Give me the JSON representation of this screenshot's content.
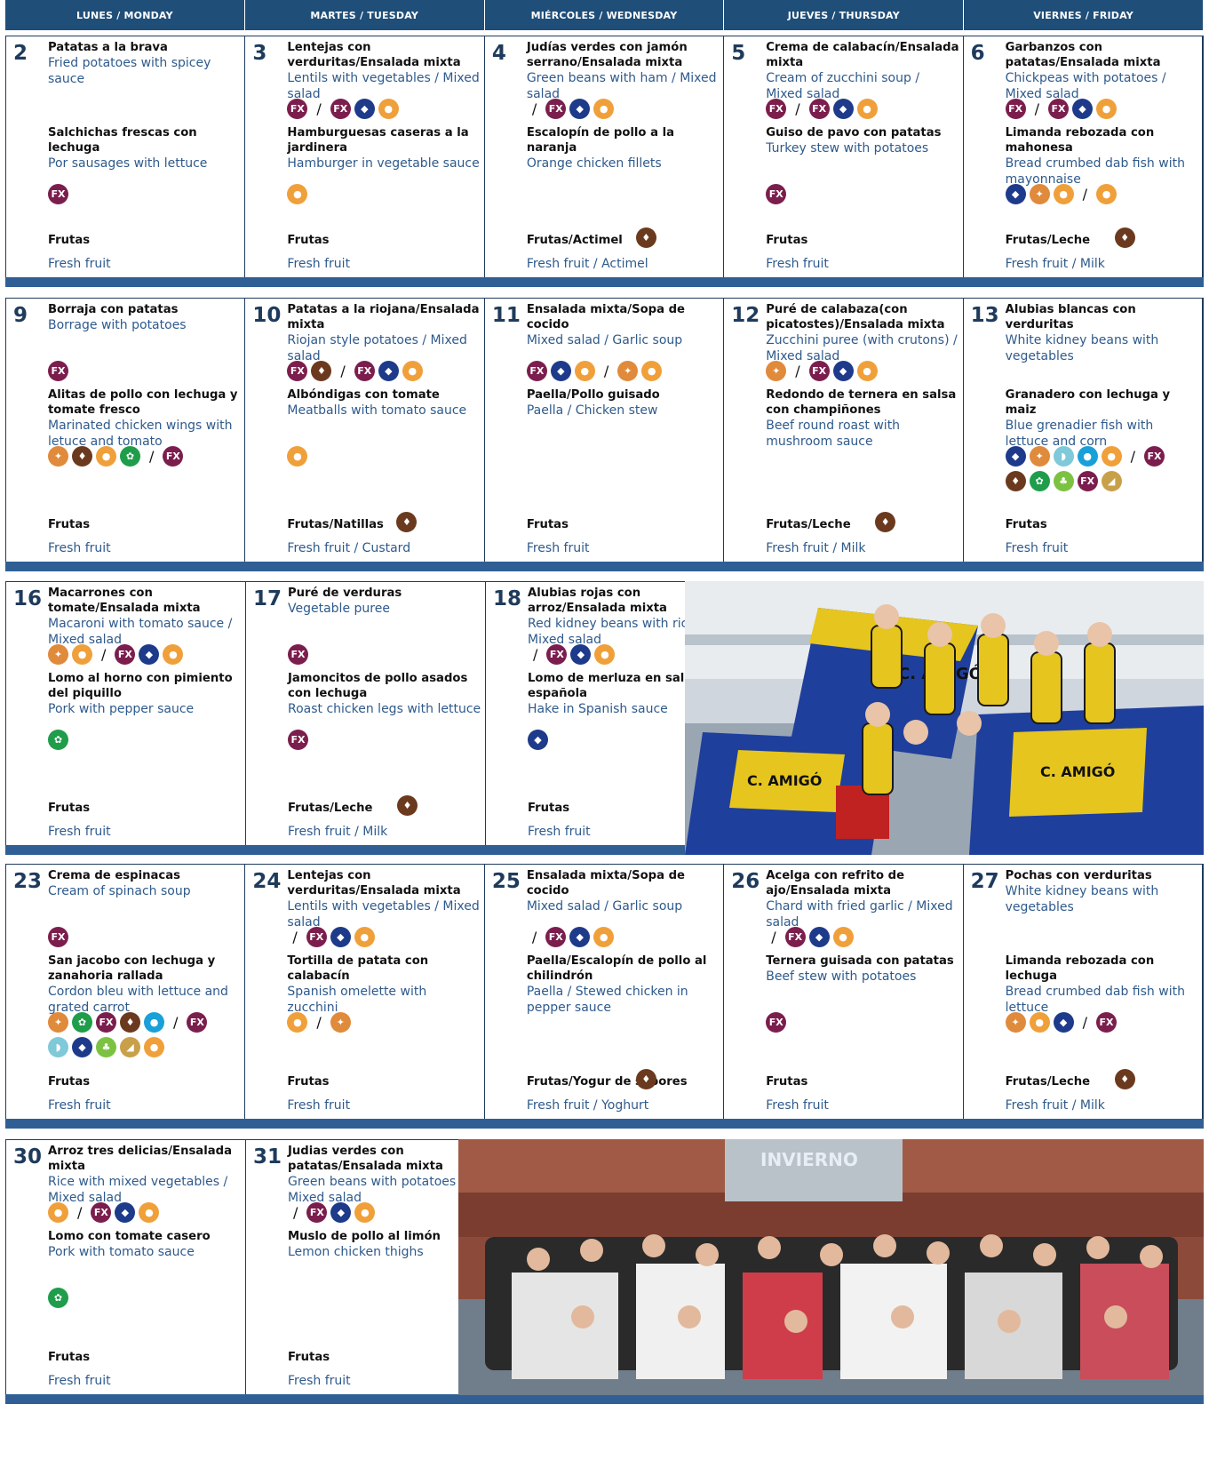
{
  "header": [
    "LUNES / MONDAY",
    "MARTES / TUESDAY",
    "MIÉRCOLES / WEDNESDAY",
    "JUEVES / THURSDAY",
    "VIERNES / FRIDAY"
  ],
  "weeks": [
    {
      "days": [
        {
          "num": "2",
          "d1es": "Patatas a la brava",
          "d1en": "Fried potatoes with spicey sauce",
          "d2es": "Salchichas frescas con lechuga",
          "d2en": "Por sausages with lettuce",
          "fes": "Frutas",
          "fen": "Fresh fruit"
        },
        {
          "num": "3",
          "d1es": "Lentejas con verduritas/Ensalada mixta",
          "d1en": "Lentils with vegetables / Mixed salad",
          "d2es": "Hamburguesas caseras a la jardinera",
          "d2en": "Hamburger in vegetable sauce",
          "fes": "Frutas",
          "fen": "Fresh fruit"
        },
        {
          "num": "4",
          "d1es": "Judías verdes con jamón serrano/Ensalada mixta",
          "d1en": "Green beans with ham / Mixed salad",
          "d2es": "Escalopín de pollo a la naranja",
          "d2en": "Orange chicken fillets",
          "fes": "Frutas/Actimel",
          "fen": "Fresh fruit / Actimel"
        },
        {
          "num": "5",
          "d1es": "Crema de calabacín/Ensalada mixta",
          "d1en": "Cream of zucchini soup / Mixed salad",
          "d2es": "Guiso de pavo con patatas",
          "d2en": "Turkey stew with potatoes",
          "fes": "Frutas",
          "fen": "Fresh fruit"
        },
        {
          "num": "6",
          "d1es": "Garbanzos con patatas/Ensalada mixta",
          "d1en": "Chickpeas with potatoes / Mixed salad",
          "d2es": "Limanda rebozada con mahonesa",
          "d2en": "Bread crumbed dab fish with mayonnaise",
          "fes": "Frutas/Leche",
          "fen": "Fresh fruit / Milk"
        }
      ]
    },
    {
      "days": [
        {
          "num": "9",
          "d1es": "Borraja con patatas",
          "d1en": "Borrage with potatoes",
          "d2es": "Alitas de pollo con lechuga y tomate fresco",
          "d2en": "Marinated chicken wings with letuce and tomato",
          "fes": "Frutas",
          "fen": "Fresh fruit"
        },
        {
          "num": "10",
          "d1es": "Patatas a la riojana/Ensalada mixta",
          "d1en": "Riojan style potatoes / Mixed salad",
          "d2es": "Albóndigas con tomate",
          "d2en": "Meatballs with tomato sauce",
          "fes": "Frutas/Natillas",
          "fen": "Fresh fruit / Custard"
        },
        {
          "num": "11",
          "d1es": "Ensalada mixta/Sopa de cocido",
          "d1en": "Mixed salad / Garlic soup",
          "d2es": "Paella/Pollo guisado",
          "d2en": "Paella / Chicken stew",
          "fes": "Frutas",
          "fen": "Fresh fruit"
        },
        {
          "num": "12",
          "d1es": "Puré de calabaza(con picatostes)/Ensalada mixta",
          "d1en": "Zucchini puree (with crutons) / Mixed salad",
          "d2es": "Redondo de ternera en salsa con champiñones",
          "d2en": "Beef round roast with mushroom sauce",
          "fes": "Frutas/Leche",
          "fen": "Fresh fruit / Milk"
        },
        {
          "num": "13",
          "d1es": "Alubias blancas con verduritas",
          "d1en": "White kidney beans with vegetables",
          "d2es": "Granadero con lechuga y maiz",
          "d2en": "Blue grenadier fish with lettuce and corn",
          "fes": "Frutas",
          "fen": "Fresh fruit"
        }
      ]
    },
    {
      "days": [
        {
          "num": "16",
          "d1es": "Macarrones con tomate/Ensalada mixta",
          "d1en": "Macaroni with tomato sauce / Mixed salad",
          "d2es": "Lomo al horno con pimiento del piquillo",
          "d2en": "Pork with pepper sauce",
          "fes": "Frutas",
          "fen": "Fresh fruit"
        },
        {
          "num": "17",
          "d1es": "Puré de verduras",
          "d1en": "Vegetable puree",
          "d2es": "Jamoncitos de pollo  asados con lechuga",
          "d2en": "Roast chicken legs with lettuce",
          "fes": "Frutas/Leche",
          "fen": "Fresh fruit / Milk"
        },
        {
          "num": "18",
          "d1es": "Alubias rojas con arroz/Ensalada mixta",
          "d1en": "Red kidney beans with rice / Mixed salad",
          "d2es": "Lomo de merluza en salsa española",
          "d2en": "Hake in Spanish sauce",
          "fes": "Frutas",
          "fen": "Fresh fruit"
        }
      ]
    },
    {
      "days": [
        {
          "num": "23",
          "d1es": "Crema de espinacas",
          "d1en": "Cream of spinach soup",
          "d2es": "San jacobo con lechuga  y zanahoria rallada",
          "d2en": "Cordon bleu with lettuce and grated carrot",
          "fes": "Frutas",
          "fen": "Fresh fruit"
        },
        {
          "num": "24",
          "d1es": "Lentejas con verduritas/Ensalada mixta",
          "d1en": "Lentils with vegetables / Mixed salad",
          "d2es": "Tortilla de patata con calabacín",
          "d2en": "Spanish omelette with zucchini",
          "fes": "Frutas",
          "fen": "Fresh fruit"
        },
        {
          "num": "25",
          "d1es": "Ensalada mixta/Sopa de cocido",
          "d1en": "Mixed salad / Garlic soup",
          "d2es": "Paella/Escalopín de pollo al chilindrón",
          "d2en": "Paella / Stewed chicken in pepper sauce",
          "fes": "Frutas/Yogur de sabores",
          "fen": "Fresh fruit / Yoghurt"
        },
        {
          "num": "26",
          "d1es": "Acelga con refrito de ajo/Ensalada mixta",
          "d1en": "Chard with fried garlic / Mixed salad",
          "d2es": "Ternera guisada con patatas",
          "d2en": "Beef stew with potatoes",
          "fes": "Frutas",
          "fen": "Fresh fruit"
        },
        {
          "num": "27",
          "d1es": "Pochas con verduritas",
          "d1en": "White kidney beans with vegetables",
          "d2es": "Limanda rebozada con lechuga",
          "d2en": "Bread crumbed dab fish with lettuce",
          "fes": "Frutas/Leche",
          "fen": "Fresh fruit / Milk"
        }
      ]
    },
    {
      "days": [
        {
          "num": "30",
          "d1es": "Arroz tres delicias/Ensalada mixta",
          "d1en": "Rice with mixed vegetables / Mixed salad",
          "d2es": "Lomo con tomate casero",
          "d2en": "Pork with tomato sauce",
          "fes": "Frutas",
          "fen": "Fresh fruit"
        },
        {
          "num": "31",
          "d1es": "Judias verdes con patatas/Ensalada mixta",
          "d1en": "Green beans with potatoes / Mixed salad",
          "d2es": "Muslo de pollo al limón",
          "d2en": "Lemon chicken thighs",
          "fes": "Frutas",
          "fen": "Fresh fruit"
        }
      ]
    }
  ],
  "photos": {
    "banner1": "C. AMIGÓ",
    "banner2": "C. AMIGÓ",
    "banner3": "C. AMIGÓ",
    "sign": "INVIERNO"
  },
  "icon_names": {
    "l": "lactose-allergen-icon",
    "f": "fish-allergen-icon",
    "e": "egg-allergen-icon",
    "m": "milk-allergen-icon",
    "g": "gluten-allergen-icon",
    "c": "celery-allergen-icon",
    "s": "shellfish-allergen-icon",
    "o": "mollusc-allergen-icon",
    "p": "mustard-allergen-icon",
    "u": "sesame-allergen-icon"
  }
}
